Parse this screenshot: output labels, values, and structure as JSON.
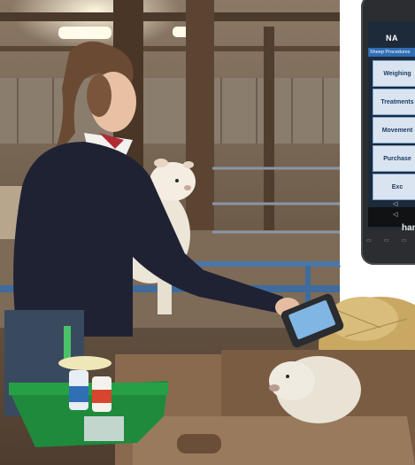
{
  "app": {
    "title": "NA",
    "subtitle": "Sheep Procedures",
    "menu": [
      "Weighing",
      "Treatments",
      "Movement",
      "Purchase",
      "Exc"
    ],
    "nav_symbols": [
      "◁",
      "◁"
    ],
    "brand": "han"
  },
  "colors": {
    "barn_wood": "#5a4838",
    "sweater": "#1f2233",
    "tray_green": "#1f8a3c",
    "hay": "#c9a862",
    "app_button": "#d9e4f0",
    "app_header": "#2f6db5"
  }
}
